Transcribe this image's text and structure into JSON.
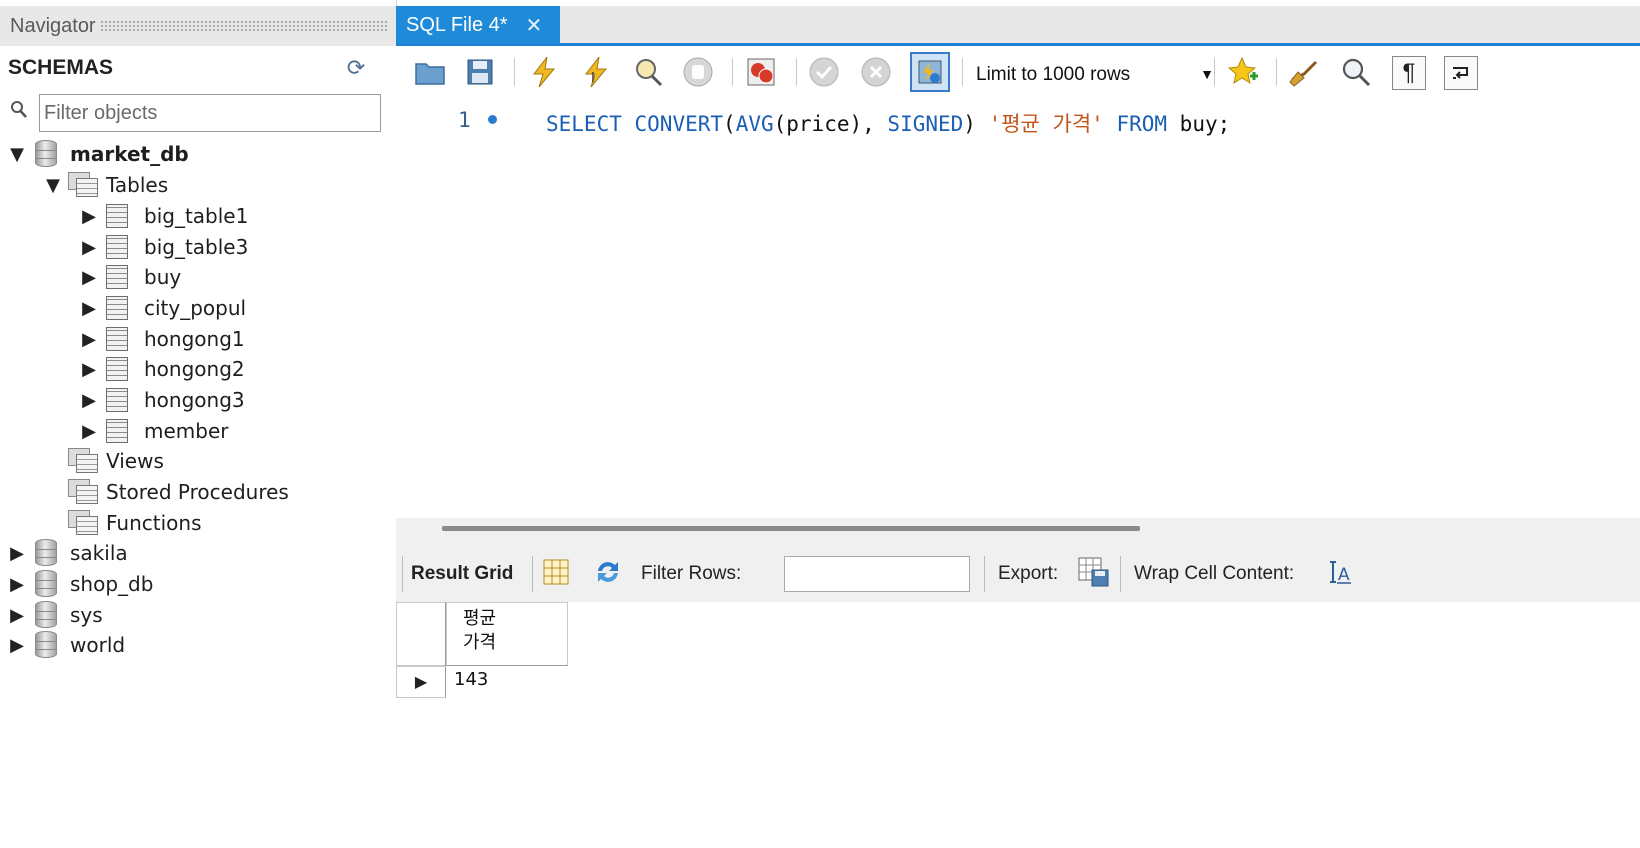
{
  "navigator": {
    "title": "Navigator",
    "schemas_label": "SCHEMAS",
    "filter_placeholder": "Filter objects",
    "tree": {
      "expanded_schema": "market_db",
      "tables_label": "Tables",
      "tables": [
        "big_table1",
        "big_table3",
        "buy",
        "city_popul",
        "hongong1",
        "hongong2",
        "hongong3",
        "member"
      ],
      "views_label": "Views",
      "procedures_label": "Stored Procedures",
      "functions_label": "Functions",
      "other_schemas": [
        "sakila",
        "shop_db",
        "sys",
        "world"
      ]
    }
  },
  "editor": {
    "tab_label": "SQL File 4*",
    "limit_label": "Limit to 1000 rows",
    "line_number": "1",
    "code": {
      "kw_select": "SELECT",
      "kw_convert": "CONVERT",
      "paren_open": "(",
      "kw_avg": "AVG",
      "arg": "(price), ",
      "kw_signed": "SIGNED",
      "paren_close": ") ",
      "alias": "'평균 가격'",
      "kw_from": "FROM",
      "table": " buy;"
    }
  },
  "results": {
    "result_grid_label": "Result Grid",
    "filter_rows_label": "Filter Rows:",
    "export_label": "Export:",
    "wrap_label": "Wrap Cell Content:",
    "column_header_line1": "평균",
    "column_header_line2": "가격",
    "rows": [
      "143"
    ]
  },
  "colors": {
    "tab_active": "#1f8ad8",
    "keyword": "#1a5fb4",
    "string": "#c0561a"
  }
}
